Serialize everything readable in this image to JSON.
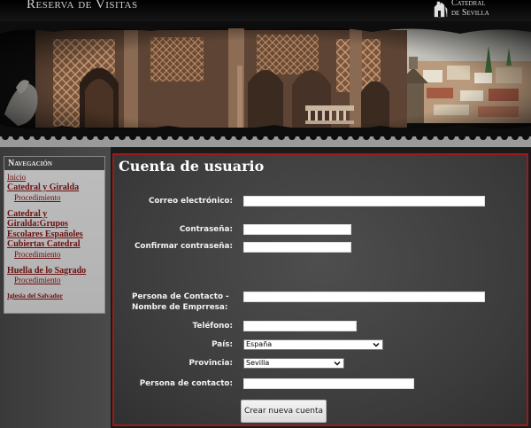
{
  "header": {
    "site_title": "Reserva de Visitas",
    "logo_line1": "Catedral",
    "logo_line2": "de Sevilla"
  },
  "sidebar": {
    "heading": "Navegación",
    "items": [
      {
        "label": "Inicio"
      },
      {
        "label": "Catedral y Giralda"
      },
      {
        "label": "Procedimiento"
      },
      {
        "label": "Catedral y Giralda:Grupos Escolares Españoles"
      },
      {
        "label": "Cubiertas Catedral"
      },
      {
        "label": "Procedimiento"
      },
      {
        "label": "Huella de lo Sagrado"
      },
      {
        "label": "Procedimiento"
      },
      {
        "label": "Iglesia del Salvador"
      }
    ]
  },
  "form": {
    "title": "Cuenta de usuario",
    "email_label": "Correo electrónico:",
    "password_label": "Contraseña:",
    "confirm_label": "Confirmar contraseña:",
    "company_label": "Persona de Contacto - Nombre de Emprresa:",
    "phone_label": "Teléfono:",
    "country_label": "País:",
    "country_value": "España",
    "province_label": "Provincia:",
    "province_value": "Sevilla",
    "contact_label": "Persona de contacto:",
    "submit_label": "Crear nueva cuenta"
  },
  "colors": {
    "accent_border": "#9e1a1a",
    "link": "#6a0e0e",
    "panel": "#444444"
  }
}
